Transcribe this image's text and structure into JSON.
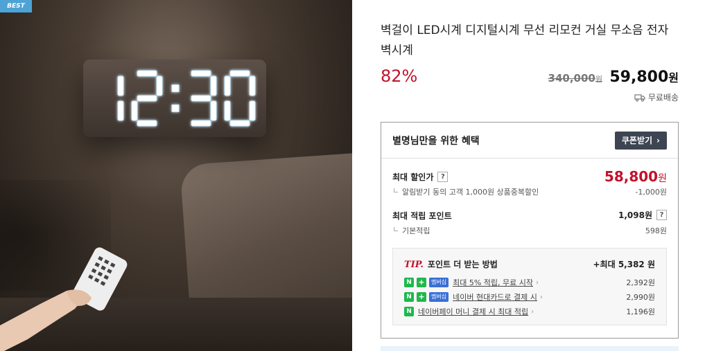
{
  "hero": {
    "badge": "BEST",
    "clock_time": "12:30",
    "colors": {
      "led": "#ffffff",
      "led_glow": "#bfe8ff",
      "badge_bg": "#4da3d6"
    }
  },
  "product": {
    "title": "벽걸이 LED시계 디지털시계 무선 리모컨 거실 무소음 전자벽시계",
    "discount_rate": "82%",
    "original_price": "340,000",
    "original_price_unit": "원",
    "sale_price": "59,800",
    "sale_price_unit": "원",
    "shipping_icon": "truck-icon",
    "shipping_text": "무료배송"
  },
  "benefit": {
    "title": "별명님만을 위한 혜택",
    "coupon_button": "쿠폰받기",
    "max_discount": {
      "label": "최대 할인가",
      "help": "?",
      "price": "58,800",
      "unit": "원",
      "sub_label": "알림받기 동의 고객 1,000원 상품중복할인",
      "sub_value": "-1,000원"
    },
    "max_point": {
      "label": "최대 적립 포인트",
      "value": "1,098원",
      "help": "?",
      "sub_label": "기본적립",
      "sub_value": "598원"
    },
    "tip": {
      "tag": "TIP.",
      "title": "포인트 더 받는 방법",
      "max": "+최대 5,382 원",
      "items": [
        {
          "badge": "멤버십",
          "text": "최대 5% 적립, 무료 시작",
          "value": "2,392원"
        },
        {
          "badge": "멤버십",
          "text": "네이버 현대카드로 결제 시",
          "value": "2,990원"
        },
        {
          "badge": "",
          "text": "네이버페이 머니 결제 시 최대 적립",
          "value": "1,196원"
        }
      ]
    }
  },
  "colors": {
    "accent_red": "#c3112c",
    "button_dark": "#3d4452",
    "naver_green": "#1fb84c",
    "member_blue": "#3a6fd6"
  }
}
